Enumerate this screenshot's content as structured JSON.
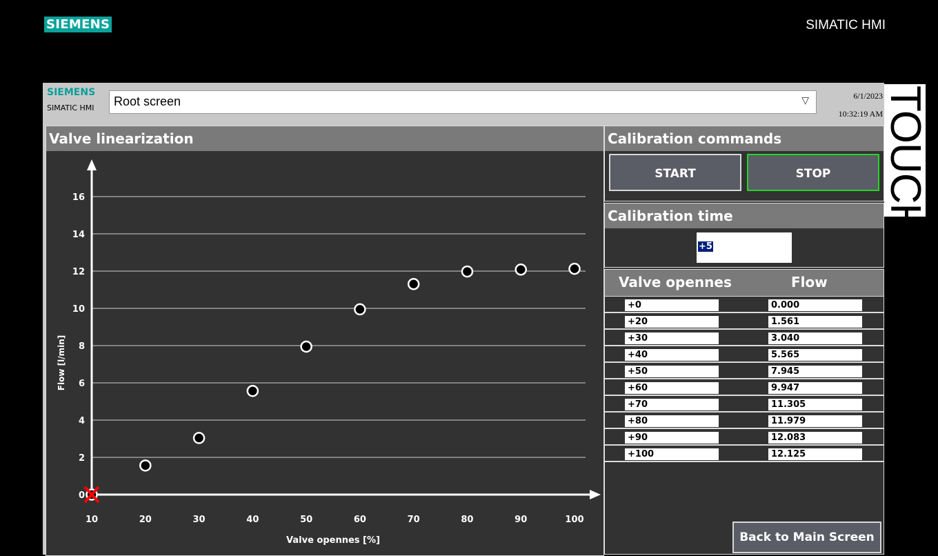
{
  "device": {
    "brand": "SIEMENS",
    "product": "SIMATIC HMI",
    "side_label": "TOUCH"
  },
  "header": {
    "brand": "SIEMENS",
    "sub": "SIMATIC HMI",
    "screen_name": "Root screen",
    "date": "6/1/2023",
    "time": "10:32:19 AM"
  },
  "chart_panel": {
    "title": "Valve linearization"
  },
  "chart_data": {
    "type": "scatter",
    "xlabel": "Valve opennes [%]",
    "ylabel": "Flow [l/min]",
    "x_ticks": [
      "10",
      "20",
      "30",
      "40",
      "50",
      "60",
      "70",
      "80",
      "90",
      "100"
    ],
    "y_ticks": [
      "0",
      "2",
      "4",
      "6",
      "8",
      "10",
      "12",
      "14",
      "16"
    ],
    "xlim": [
      10,
      100
    ],
    "ylim": [
      0,
      16
    ],
    "grid": "horizontal",
    "points": [
      {
        "x": 10,
        "y": 0.0
      },
      {
        "x": 20,
        "y": 1.561
      },
      {
        "x": 30,
        "y": 3.04
      },
      {
        "x": 40,
        "y": 5.565
      },
      {
        "x": 50,
        "y": 7.945
      },
      {
        "x": 60,
        "y": 9.947
      },
      {
        "x": 70,
        "y": 11.305
      },
      {
        "x": 80,
        "y": 11.979
      },
      {
        "x": 90,
        "y": 12.083
      },
      {
        "x": 100,
        "y": 12.125
      }
    ],
    "cursor_marker": {
      "x": 10,
      "y": 0,
      "symbol": "x",
      "color": "#ff0000"
    }
  },
  "calibration": {
    "commands_title": "Calibration commands",
    "start_label": "START",
    "stop_label": "STOP",
    "time_title": "Calibration time",
    "time_value": "+5"
  },
  "table": {
    "col1": "Valve opennes",
    "col2": "Flow",
    "rows": [
      {
        "opening": "+0",
        "flow": "0.000"
      },
      {
        "opening": "+20",
        "flow": "1.561"
      },
      {
        "opening": "+30",
        "flow": "3.040"
      },
      {
        "opening": "+40",
        "flow": "5.565"
      },
      {
        "opening": "+50",
        "flow": "7.945"
      },
      {
        "opening": "+60",
        "flow": "9.947"
      },
      {
        "opening": "+70",
        "flow": "11.305"
      },
      {
        "opening": "+80",
        "flow": "11.979"
      },
      {
        "opening": "+90",
        "flow": "12.083"
      },
      {
        "opening": "+100",
        "flow": "12.125"
      }
    ]
  },
  "nav": {
    "back_label": "Back to Main Screen"
  },
  "colors": {
    "accent": "#0aa39b",
    "stop_border": "#27d327",
    "marker": "#ff0000"
  }
}
